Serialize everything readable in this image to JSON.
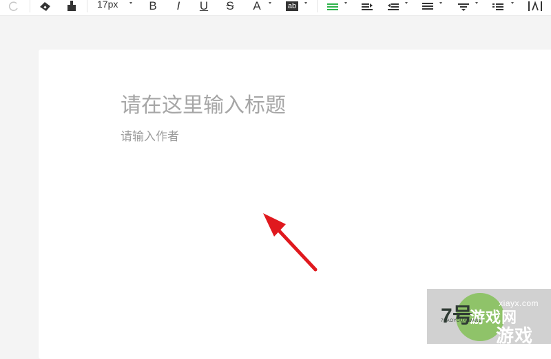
{
  "toolbar": {
    "font_size": "17px",
    "bold_label": "B",
    "italic_label": "I",
    "underline_label": "U",
    "strike_label": "S",
    "font_color_label": "A",
    "highlight_label": "ab",
    "icons": [
      "redo-icon",
      "eraser-icon",
      "format-painter-icon",
      "bold-icon",
      "italic-icon",
      "underline-icon",
      "strikethrough-icon",
      "font-color-icon",
      "highlight-icon",
      "align-center-icon",
      "indent-icon",
      "outdent-icon",
      "line-height-icon",
      "paragraph-spacing-icon",
      "list-icon",
      "letter-spacing-icon"
    ],
    "active_color": "#2db34a"
  },
  "editor": {
    "title_placeholder": "请在这里输入标题",
    "author_placeholder": "请输入作者"
  },
  "annotation": {
    "arrow_color": "#e0191e"
  },
  "watermark": {
    "number": "7号",
    "brand": "游戏网",
    "pinyin": "7HAOYOUXIWANG",
    "site": "xiayx.com",
    "chinese": "游戏"
  }
}
